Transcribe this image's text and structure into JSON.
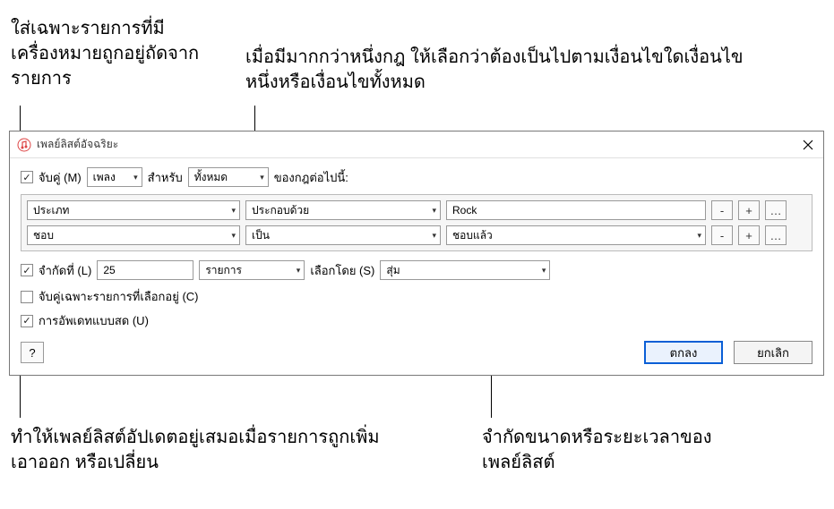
{
  "annotations": {
    "topLeft": "ใส่เฉพาะรายการที่มีเครื่องหมายถูกอยู่ถัดจากรายการ",
    "topRight": "เมื่อมีมากกว่าหนึ่งกฎ ให้เลือกว่าต้องเป็นไปตามเงื่อนไขใดเงื่อนไขหนึ่งหรือเงื่อนไขทั้งหมด",
    "bottomLeft": "ทำให้เพลย์ลิสต์อัปเดตอยู่เสมอเมื่อรายการถูกเพิ่ม เอาออก หรือเปลี่ยน",
    "bottomRight": "จำกัดขนาดหรือระยะเวลาของเพลย์ลิสต์"
  },
  "dialog": {
    "title": "เพลย์ลิสต์อัจฉริยะ",
    "match": {
      "checkboxLabel": "จับคู่ (M)",
      "mediaType": "เพลง",
      "forLabel": "สำหรับ",
      "scope": "ทั้งหมด",
      "suffix": "ของกฎต่อไปนี้:"
    },
    "rules": [
      {
        "field": "ประเภท",
        "op": "ประกอบด้วย",
        "value": "Rock",
        "valueType": "text"
      },
      {
        "field": "ชอบ",
        "op": "เป็น",
        "value": "ชอบแล้ว",
        "valueType": "select"
      }
    ],
    "limit": {
      "checkboxLabel": "จำกัดที่ (L)",
      "value": "25",
      "unit": "รายการ",
      "selectedByLabel": "เลือกโดย (S)",
      "selectedBy": "สุ่ม"
    },
    "matchChecked": {
      "label": "จับคู่เฉพาะรายการที่เลือกอยู่ (C)"
    },
    "liveUpdate": {
      "label": "การอัพเดทแบบสด (U)"
    },
    "buttons": {
      "help": "?",
      "ok": "ตกลง",
      "cancel": "ยกเลิก",
      "minus": "-",
      "plus": "+",
      "more": "…"
    }
  }
}
